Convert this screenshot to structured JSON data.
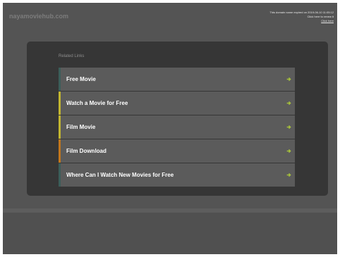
{
  "header": {
    "domain": "nayamoviehub.com",
    "notice_line1": "This domain name expired on 2019-06-10 11:05:12",
    "notice_line2": "Click here to renew it",
    "notice_link": "Click here"
  },
  "panel": {
    "title": "Related Links",
    "links": [
      {
        "label": "Free Movie",
        "accent": "#3c5e5a"
      },
      {
        "label": "Watch a Movie for Free",
        "accent": "#c3b631"
      },
      {
        "label": "Film Movie",
        "accent": "#c3b631"
      },
      {
        "label": "Film Download",
        "accent": "#c2771d"
      },
      {
        "label": "Where Can I Watch New Movies for Free",
        "accent": "#3c5e5a"
      }
    ],
    "arrow_color": "#a8c33b",
    "arrow_icon": "arrow-right-icon"
  }
}
